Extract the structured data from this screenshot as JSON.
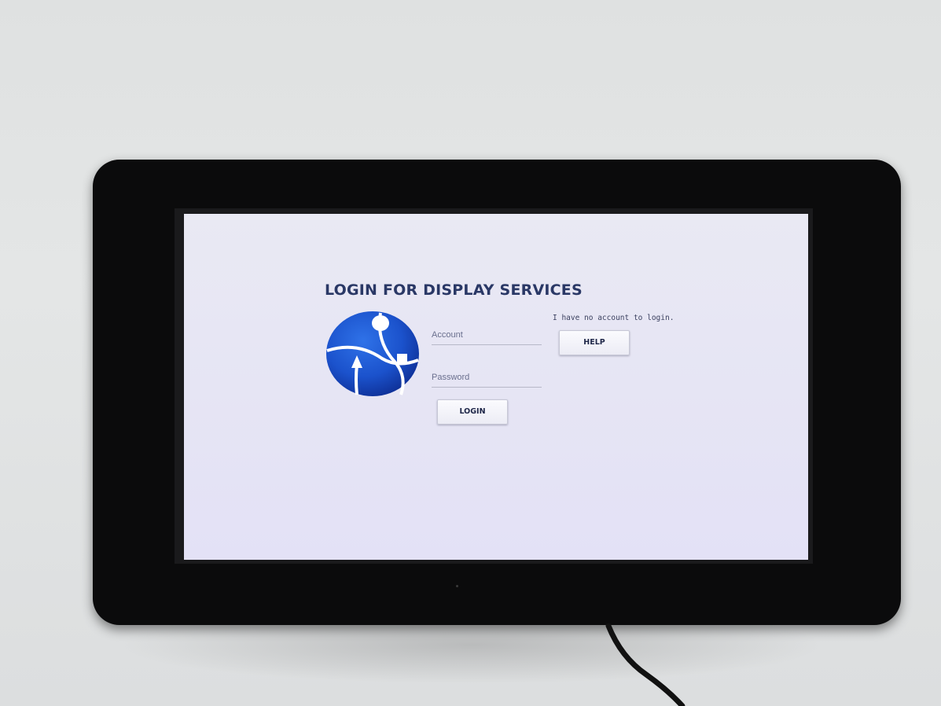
{
  "app": {
    "title": "LOGIN FOR DISPLAY SERVICES"
  },
  "logo": {
    "icon": "globe-route-icon",
    "colors": {
      "primary": "#1d5bd6",
      "dark": "#0d2f92",
      "lines": "#ffffff"
    }
  },
  "form": {
    "account_placeholder": "Account",
    "account_value": "",
    "password_placeholder": "Password",
    "password_value": "",
    "login_label": "LOGIN"
  },
  "help": {
    "message": "I have no account to login.",
    "button_label": "HELP"
  },
  "colors": {
    "title": "#2a3866",
    "screen_background": "#e7e6f4",
    "bezel": "#0b0b0c"
  }
}
